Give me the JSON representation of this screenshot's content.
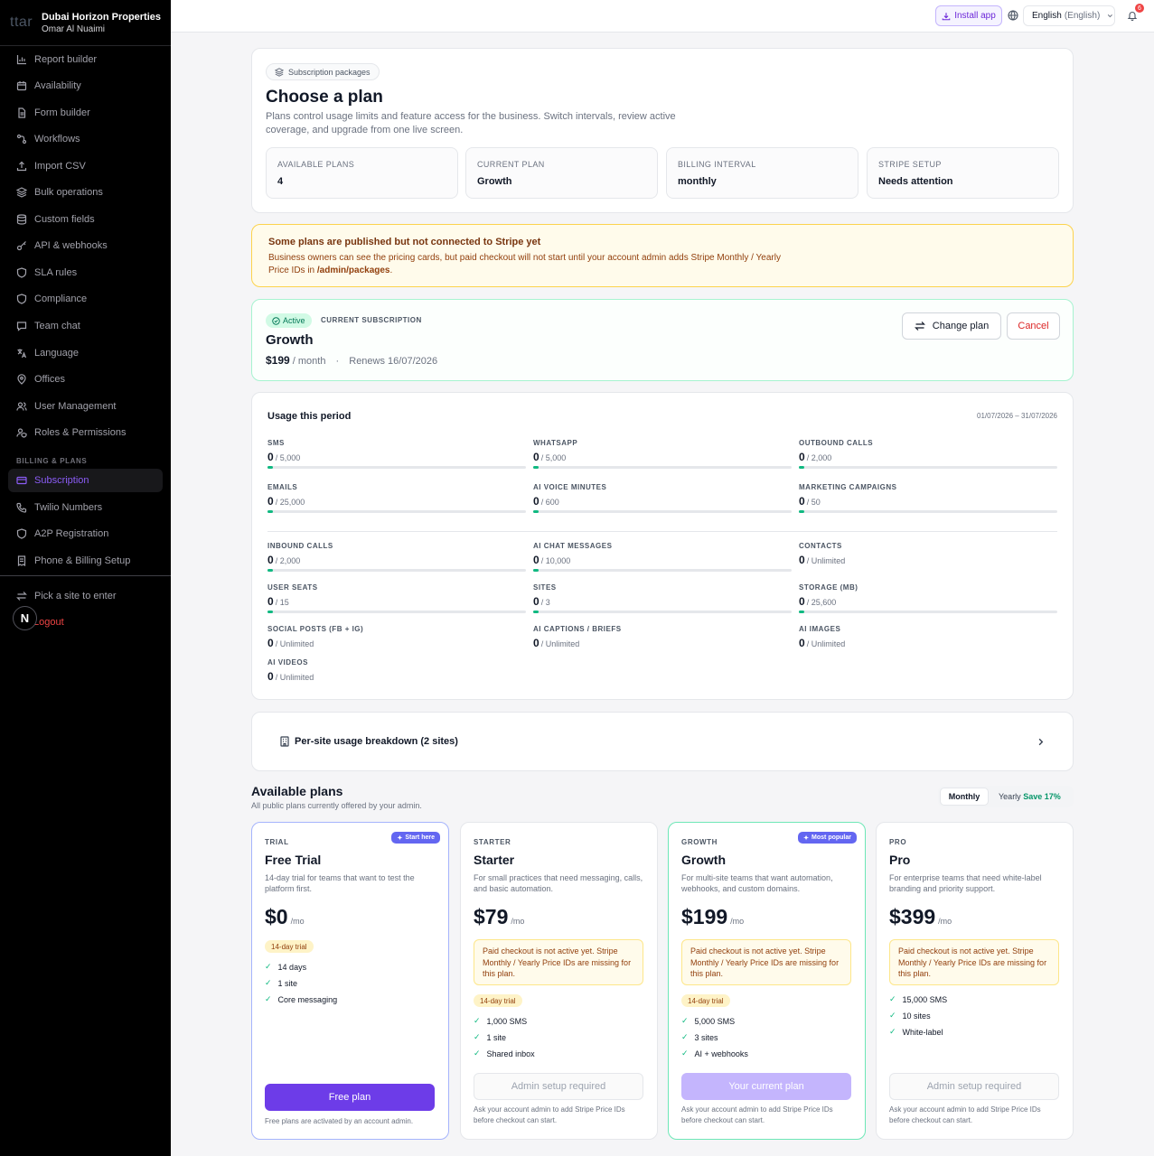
{
  "sidebar": {
    "logo": "ttar",
    "org_name": "Dubai Horizon Properties",
    "user_name": "Omar Al Nuaimi",
    "items": [
      {
        "label": "Report builder",
        "icon": "chart-icon"
      },
      {
        "label": "Availability",
        "icon": "calendar-icon"
      },
      {
        "label": "Form builder",
        "icon": "document-icon"
      },
      {
        "label": "Workflows",
        "icon": "workflow-icon"
      },
      {
        "label": "Import CSV",
        "icon": "upload-icon"
      },
      {
        "label": "Bulk operations",
        "icon": "layers-icon"
      },
      {
        "label": "Custom fields",
        "icon": "database-icon"
      },
      {
        "label": "API & webhooks",
        "icon": "key-icon"
      },
      {
        "label": "SLA rules",
        "icon": "shield-icon"
      },
      {
        "label": "Compliance",
        "icon": "shield-icon"
      },
      {
        "label": "Team chat",
        "icon": "chat-icon"
      },
      {
        "label": "Language",
        "icon": "translate-icon"
      },
      {
        "label": "Offices",
        "icon": "map-pin-icon"
      },
      {
        "label": "User Management",
        "icon": "users-icon"
      },
      {
        "label": "Roles & Permissions",
        "icon": "user-shield-icon"
      }
    ],
    "billing_section_label": "BILLING & PLANS",
    "billing_items": [
      {
        "label": "Subscription",
        "icon": "card-icon"
      },
      {
        "label": "Twilio Numbers",
        "icon": "phone-icon"
      },
      {
        "label": "A2P Registration",
        "icon": "shield-icon"
      },
      {
        "label": "Phone & Billing Setup",
        "icon": "receipt-icon"
      }
    ],
    "pick_site_label": "Pick a site to enter",
    "logout_label": "Logout",
    "next_badge": "N"
  },
  "topbar": {
    "install_label": "Install app",
    "language_label": "English",
    "language_native": "(English)",
    "notification_count": "6"
  },
  "header": {
    "badge_label": "Subscription packages",
    "title": "Choose a plan",
    "description": "Plans control usage limits and feature access for the business. Switch intervals, review active coverage, and upgrade from one live screen.",
    "stats": [
      {
        "label": "AVAILABLE PLANS",
        "value": "4"
      },
      {
        "label": "CURRENT PLAN",
        "value": "Growth"
      },
      {
        "label": "BILLING INTERVAL",
        "value": "monthly"
      },
      {
        "label": "STRIPE SETUP",
        "value": "Needs attention"
      }
    ]
  },
  "warning": {
    "title": "Some plans are published but not connected to Stripe yet",
    "body_before": "Business owners can see the pricing cards, but paid checkout will not start until your account admin adds Stripe Monthly / Yearly Price IDs in ",
    "body_path": "/admin/packages",
    "body_after": "."
  },
  "current_subscription": {
    "status": "Active",
    "label": "CURRENT SUBSCRIPTION",
    "plan_name": "Growth",
    "price": "$199",
    "period": "/ month",
    "separator": "·",
    "renews": "Renews 16/07/2026",
    "change_label": "Change plan",
    "cancel_label": "Cancel"
  },
  "usage": {
    "title": "Usage this period",
    "range": "01/07/2026 – 31/07/2026",
    "items": [
      {
        "label": "SMS",
        "used": "0",
        "limit": "/ 5,000",
        "fraction": 0
      },
      {
        "label": "WHATSAPP",
        "used": "0",
        "limit": "/ 5,000",
        "fraction": 0
      },
      {
        "label": "OUTBOUND CALLS",
        "used": "0",
        "limit": "/ 2,000",
        "fraction": 0
      },
      {
        "label": "EMAILS",
        "used": "0",
        "limit": "/ 25,000",
        "fraction": 0
      },
      {
        "label": "AI VOICE MINUTES",
        "used": "0",
        "limit": "/ 600",
        "fraction": 0
      },
      {
        "label": "MARKETING CAMPAIGNS",
        "used": "0",
        "limit": "/ 50",
        "fraction": 0
      },
      {
        "label": "INBOUND CALLS",
        "used": "0",
        "limit": "/ 2,000",
        "fraction": 0
      },
      {
        "label": "AI CHAT MESSAGES",
        "used": "0",
        "limit": "/ 10,000",
        "fraction": 0
      },
      {
        "label": "CONTACTS",
        "used": "0",
        "limit": "/ Unlimited"
      },
      {
        "label": "USER SEATS",
        "used": "0",
        "limit": "/ 15",
        "fraction": 0
      },
      {
        "label": "SITES",
        "used": "0",
        "limit": "/ 3",
        "fraction": 0
      },
      {
        "label": "STORAGE (MB)",
        "used": "0",
        "limit": "/ 25,600",
        "fraction": 0
      },
      {
        "label": "SOCIAL POSTS (FB + IG)",
        "used": "0",
        "limit": "/ Unlimited"
      },
      {
        "label": "AI CAPTIONS / BRIEFS",
        "used": "0",
        "limit": "/ Unlimited"
      },
      {
        "label": "AI IMAGES",
        "used": "0",
        "limit": "/ Unlimited"
      },
      {
        "label": "AI VIDEOS",
        "used": "0",
        "limit": "/ Unlimited"
      }
    ]
  },
  "breakdown_label": "Per-site usage breakdown (2 sites)",
  "plans_section": {
    "title": "Available plans",
    "subtitle": "All public plans currently offered by your admin.",
    "toggle_monthly": "Monthly",
    "toggle_yearly": "Yearly",
    "toggle_save": "Save 17%"
  },
  "plans": [
    {
      "tier": "TRIAL",
      "name": "Free Trial",
      "description": "14-day trial for teams that want to test the platform first.",
      "price": "$0",
      "per": "/mo",
      "ribbon": "Start here",
      "trial_badge": "14-day trial",
      "features": [
        "14 days",
        "1 site",
        "Core messaging"
      ],
      "button": "Free plan",
      "note": "Free plans are activated by an account admin."
    },
    {
      "tier": "STARTER",
      "name": "Starter",
      "description": "For small practices that need messaging, calls, and basic automation.",
      "price": "$79",
      "per": "/mo",
      "notice": "Paid checkout is not active yet. Stripe Monthly / Yearly Price IDs are missing for this plan.",
      "trial_badge": "14-day trial",
      "features": [
        "1,000 SMS",
        "1 site",
        "Shared inbox"
      ],
      "button": "Admin setup required",
      "note": "Ask your account admin to add Stripe Price IDs before checkout can start."
    },
    {
      "tier": "GROWTH",
      "name": "Growth",
      "description": "For multi-site teams that want automation, webhooks, and custom domains.",
      "price": "$199",
      "per": "/mo",
      "ribbon": "Most popular",
      "notice": "Paid checkout is not active yet. Stripe Monthly / Yearly Price IDs are missing for this plan.",
      "trial_badge": "14-day trial",
      "features": [
        "5,000 SMS",
        "3 sites",
        "AI + webhooks"
      ],
      "button": "Your current plan",
      "note": "Ask your account admin to add Stripe Price IDs before checkout can start."
    },
    {
      "tier": "PRO",
      "name": "Pro",
      "description": "For enterprise teams that need white-label branding and priority support.",
      "price": "$399",
      "per": "/mo",
      "notice": "Paid checkout is not active yet. Stripe Monthly / Yearly Price IDs are missing for this plan.",
      "features": [
        "15,000 SMS",
        "10 sites",
        "White-label"
      ],
      "button": "Admin setup required",
      "note": "Ask your account admin to add Stripe Price IDs before checkout can start."
    }
  ],
  "colors": {
    "accent": "#6d3ce8",
    "success": "#10b981",
    "warning_bg": "#fffbeb",
    "danger": "#dc2626"
  }
}
